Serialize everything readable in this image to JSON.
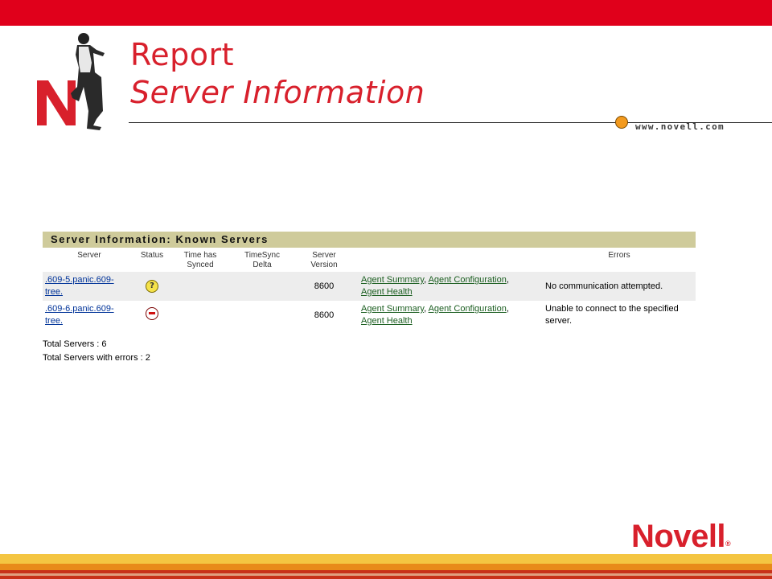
{
  "header": {
    "title_line1": "Report",
    "title_line2": "Server Information",
    "url": "www.novell.com"
  },
  "colors": {
    "brand_red": "#E0001B",
    "title_red": "#D8202C",
    "section_header_bg": "#CFCB9B",
    "accent_orange": "#F39A1E"
  },
  "report": {
    "section_title": "Server Information: Known Servers",
    "columns": [
      "Server",
      "Status",
      "Time has Synced",
      "TimeSync Delta",
      "Server Version",
      "",
      "Errors"
    ],
    "columns_split": {
      "server": "Server",
      "status": "Status",
      "time_synced_1": "Time has",
      "time_synced_2": "Synced",
      "timesync_delta_1": "TimeSync",
      "timesync_delta_2": "Delta",
      "server_version_1": "Server",
      "server_version_2": "Version",
      "errors": "Errors"
    },
    "rows": [
      {
        "server_line1": ".609-5.panic.609-",
        "server_line2": "tree.",
        "status_icon": "question-icon",
        "time_synced": "",
        "timesync_delta": "",
        "version": "8600",
        "link1": "Agent Summary",
        "link2": "Agent Configuration",
        "link3": "Agent Health",
        "error": "No communication attempted."
      },
      {
        "server_line1": ".609-6.panic.609-",
        "server_line2": "tree.",
        "status_icon": "error-icon",
        "time_synced": "",
        "timesync_delta": "",
        "version": "8600",
        "link1": "Agent Summary",
        "link2": "Agent Configuration",
        "link3": "Agent Health",
        "error": "Unable to connect to the specified server."
      }
    ],
    "totals": {
      "servers": "Total Servers : 6",
      "servers_with_errors": "Total Servers with errors : 2"
    }
  },
  "footer": {
    "brand": "Novell",
    "trademark": "®"
  }
}
